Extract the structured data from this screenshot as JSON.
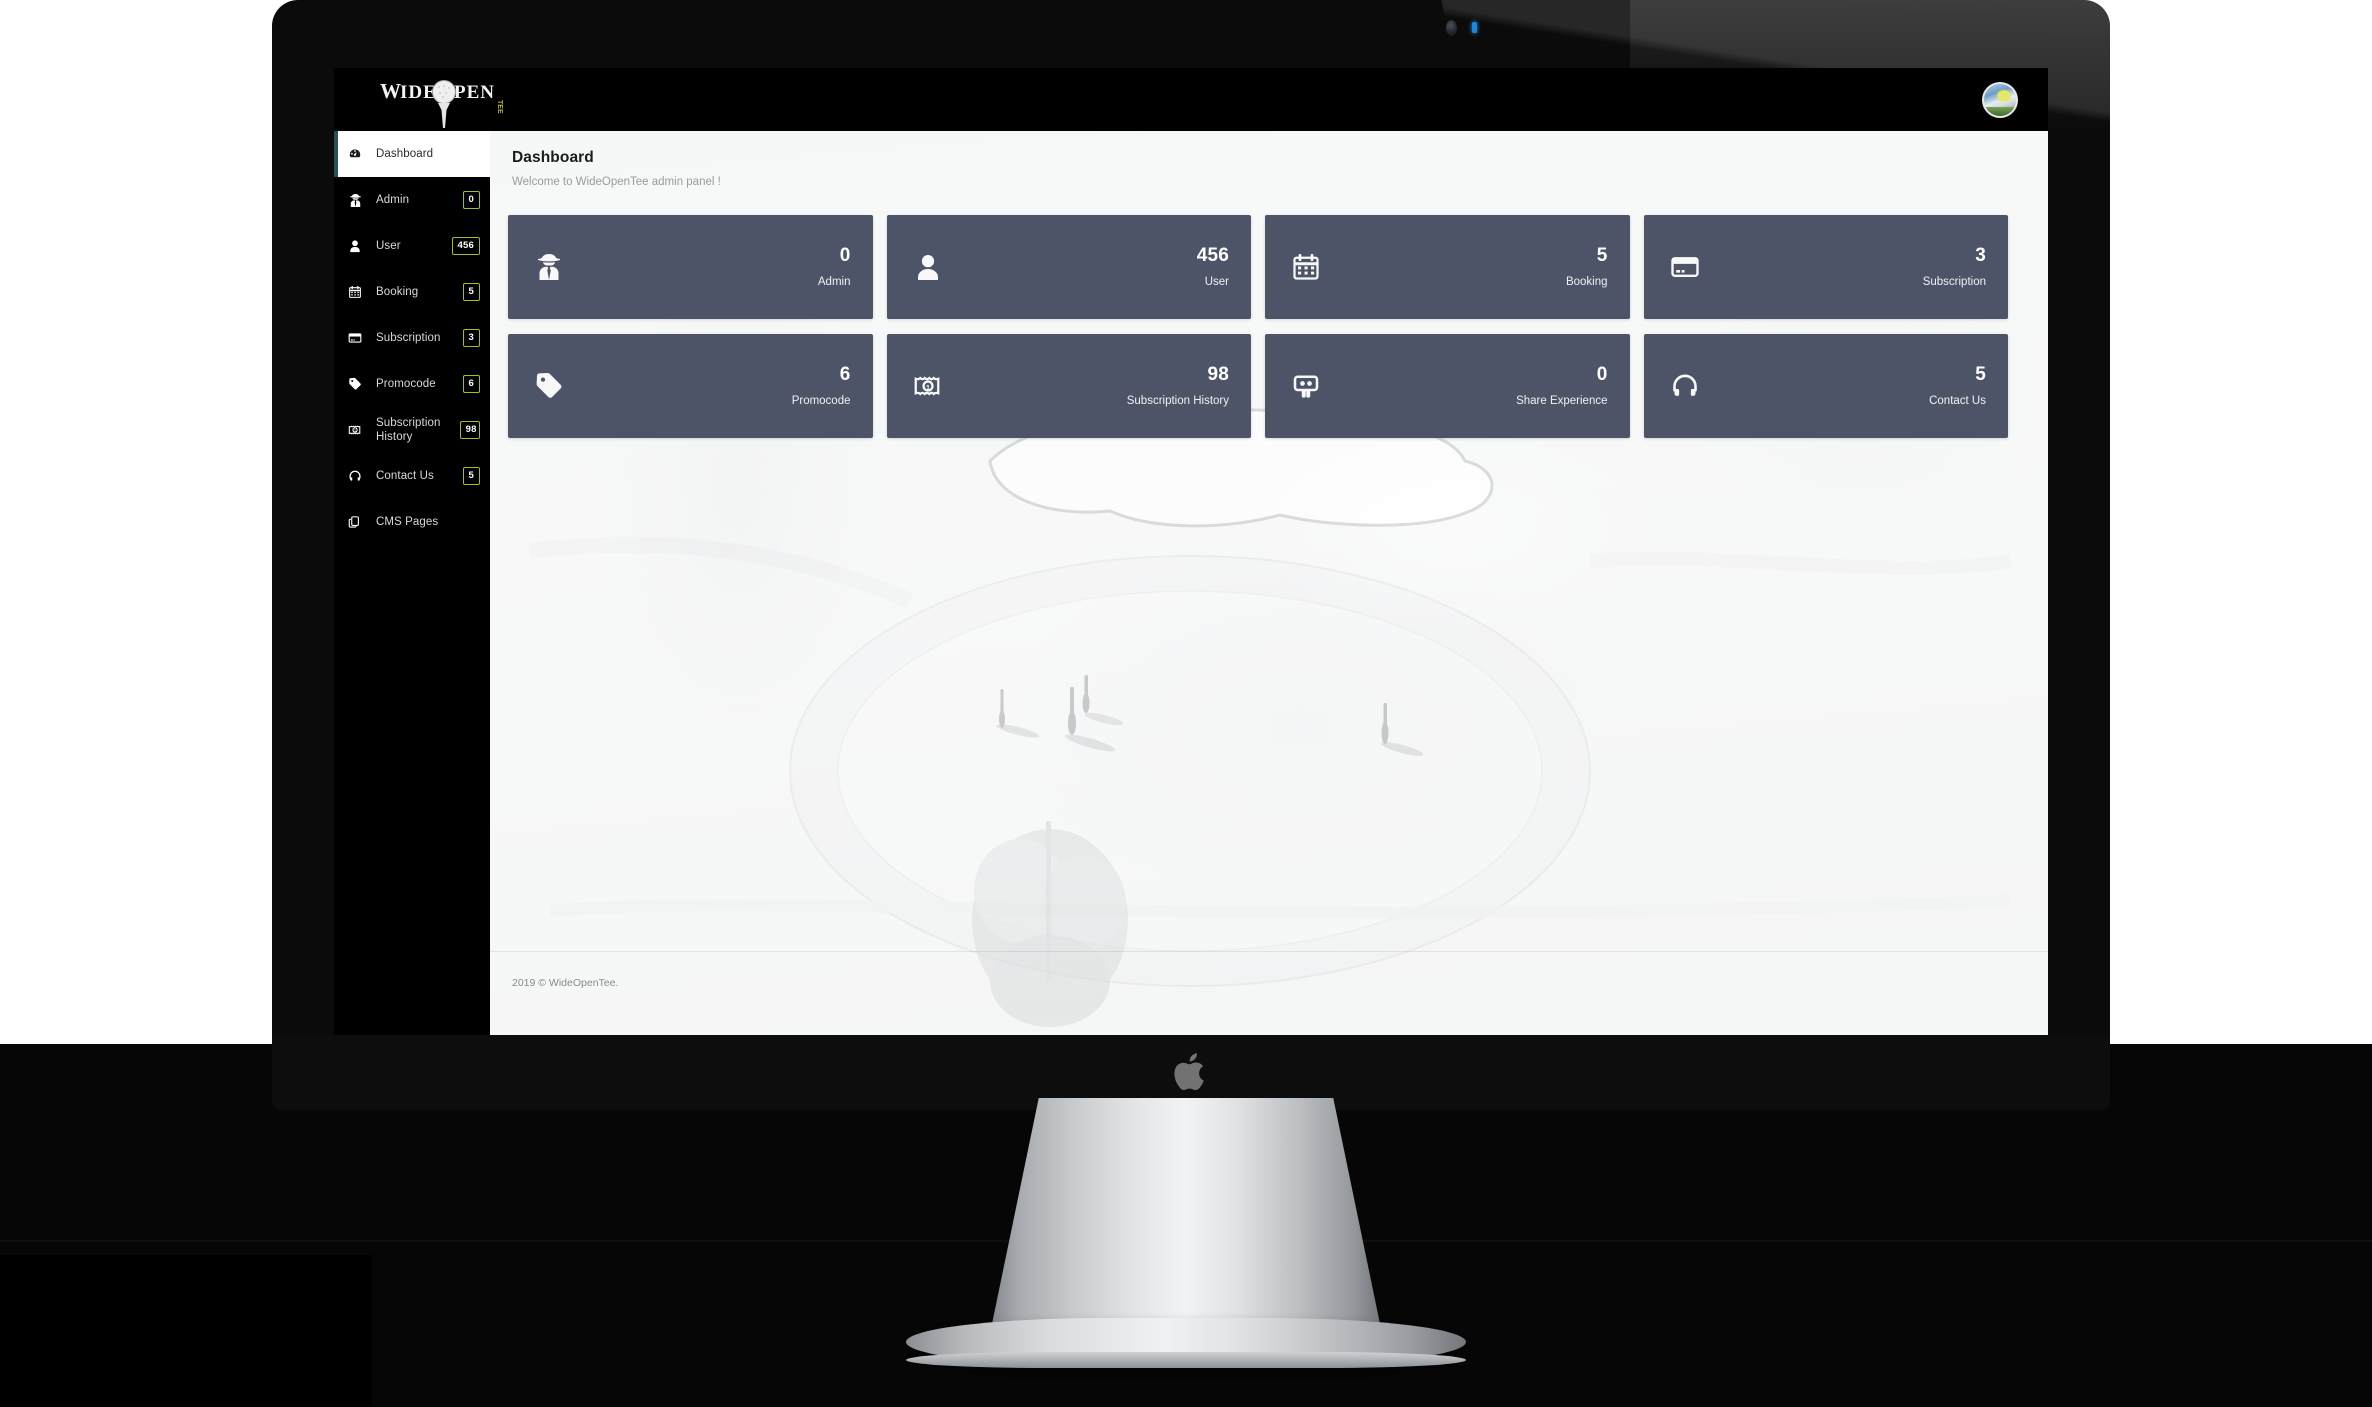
{
  "brand": {
    "name_part1": "W",
    "name_part2": "IDE",
    "name_part3": "PEN",
    "name_tee": "TEE",
    "logo_alt": "WideOpenTee"
  },
  "topbar": {
    "avatar_name": "user-avatar"
  },
  "sidebar": {
    "items": [
      {
        "label": "Dashboard",
        "icon": "dashboard-icon",
        "badge": "",
        "active": true
      },
      {
        "label": "Admin",
        "icon": "secret-agent-icon",
        "badge": "0",
        "active": false
      },
      {
        "label": "User",
        "icon": "user-icon",
        "badge": "456",
        "active": false
      },
      {
        "label": "Booking",
        "icon": "calendar-icon",
        "badge": "5",
        "active": false
      },
      {
        "label": "Subscription",
        "icon": "credit-card-icon",
        "badge": "3",
        "active": false
      },
      {
        "label": "Promocode",
        "icon": "tag-icon",
        "badge": "6",
        "active": false
      },
      {
        "label": "Subscription History",
        "icon": "money-bill-icon",
        "badge": "98",
        "active": false
      },
      {
        "label": "Contact Us",
        "icon": "headset-icon",
        "badge": "5",
        "active": false
      },
      {
        "label": "CMS Pages",
        "icon": "pages-icon",
        "badge": "",
        "active": false
      }
    ]
  },
  "main": {
    "title": "Dashboard",
    "subtitle": "Welcome to WideOpenTee admin panel !",
    "cards": [
      {
        "value": "0",
        "label": "Admin",
        "icon": "secret-agent-icon"
      },
      {
        "value": "456",
        "label": "User",
        "icon": "user-icon"
      },
      {
        "value": "5",
        "label": "Booking",
        "icon": "calendar-icon"
      },
      {
        "value": "3",
        "label": "Subscription",
        "icon": "credit-card-icon"
      },
      {
        "value": "6",
        "label": "Promocode",
        "icon": "tag-icon"
      },
      {
        "value": "98",
        "label": "Subscription History",
        "icon": "money-bill-icon"
      },
      {
        "value": "0",
        "label": "Share Experience",
        "icon": "group-icon"
      },
      {
        "value": "5",
        "label": "Contact Us",
        "icon": "headset-icon"
      }
    ]
  },
  "footer": {
    "text": "2019 © WideOpenTee."
  },
  "colors": {
    "card_bg": "#4d5467",
    "sidebar_bg": "#000000",
    "badge_border": "#9fbf2b",
    "active_accent": "#2a5055",
    "content_bg": "#fbfbfb"
  }
}
